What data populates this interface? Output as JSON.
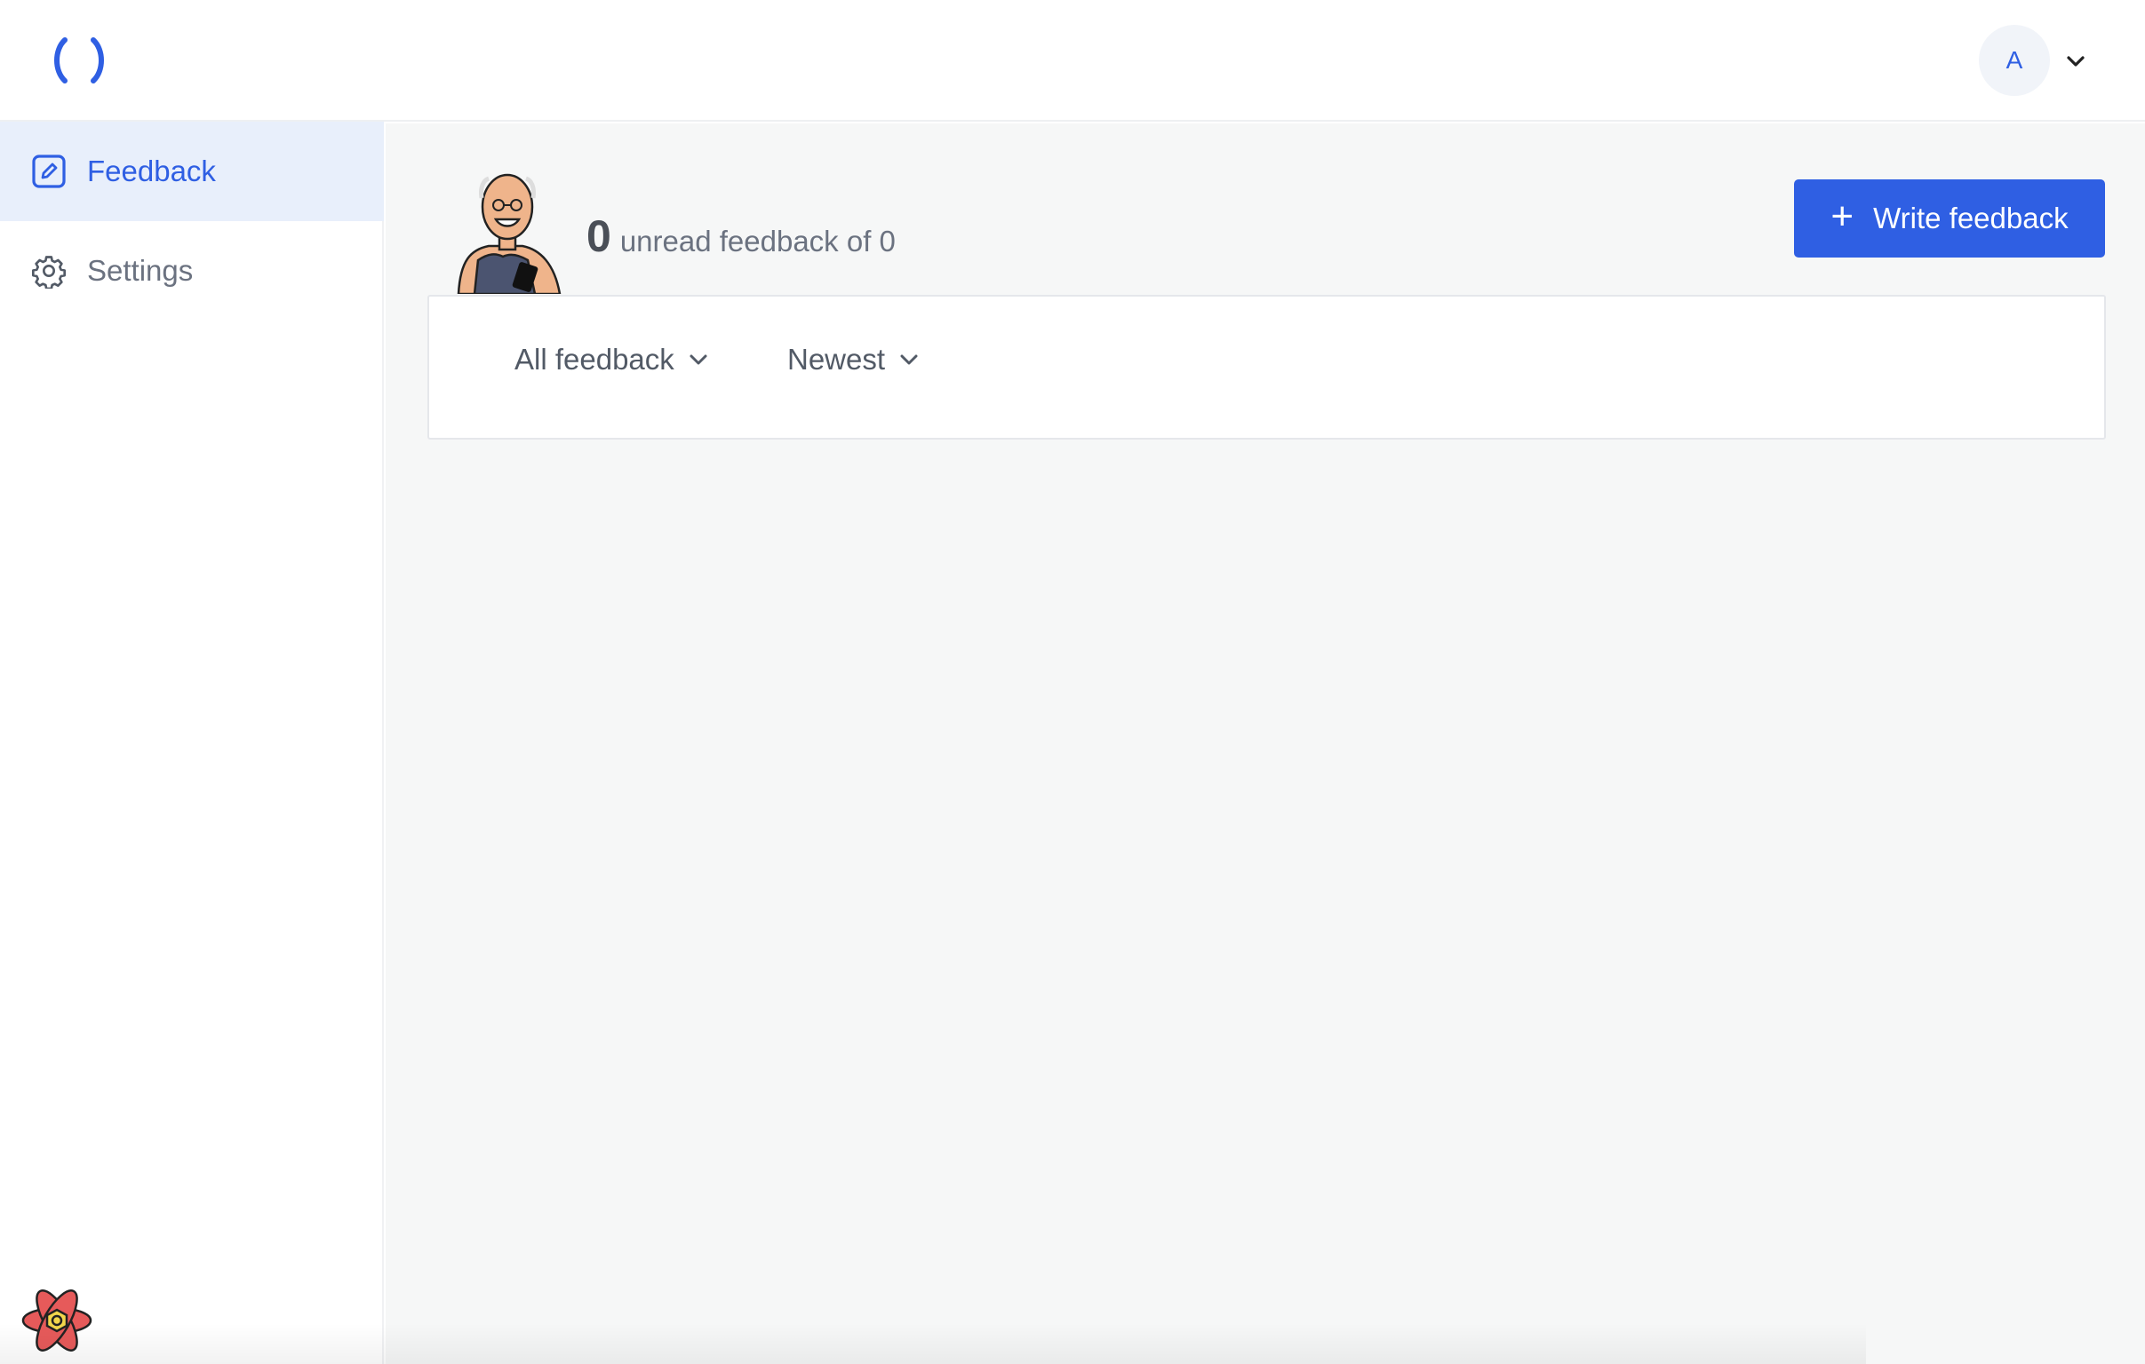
{
  "header": {
    "logo_icon": "brackets-logo-icon",
    "avatar_initial": "A",
    "menu_icon": "chevron-down-icon"
  },
  "sidebar": {
    "items": [
      {
        "label": "Feedback",
        "icon": "edit-square-icon",
        "active": true
      },
      {
        "label": "Settings",
        "icon": "gear-icon",
        "active": false
      }
    ],
    "footer_icon": "react-devtools-icon"
  },
  "main": {
    "summary": {
      "unread_count": "0",
      "text": "unread feedback of 0"
    },
    "write_button": {
      "icon": "plus-icon",
      "plus": "+",
      "label": "Write feedback"
    },
    "filters": {
      "type": {
        "selected": "All feedback",
        "icon": "chevron-down-icon"
      },
      "sort": {
        "selected": "Newest",
        "icon": "chevron-down-icon"
      }
    }
  },
  "colors": {
    "accent": "#2f5fe3",
    "accent_bg": "#e8effb",
    "main_bg": "#f6f7f7"
  }
}
